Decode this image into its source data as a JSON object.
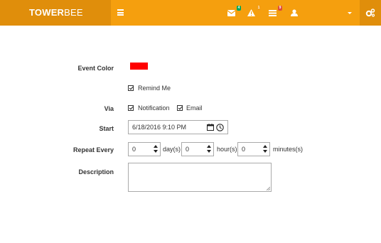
{
  "brand": {
    "bold": "TOWER",
    "light": "BEE"
  },
  "nav": {
    "messages_badge": "4",
    "alerts_badge": "1",
    "tasks_badge": "9"
  },
  "form": {
    "event_color_label": "Event Color",
    "event_color": "#ff0000",
    "remind_me_label": "Remind Me",
    "via_label": "Via",
    "via_notification_label": "Notification",
    "via_email_label": "Email",
    "start_label": "Start",
    "start_value": "6/18/2016 9:10 PM",
    "repeat_every_label": "Repeat Every",
    "repeat_days_value": "0",
    "repeat_days_unit": "day(s)",
    "repeat_hours_value": "0",
    "repeat_hours_unit": "hour(s)",
    "repeat_minutes_value": "0",
    "repeat_minutes_unit": "minutes(s)",
    "description_label": "Description",
    "description_value": ""
  },
  "colors": {
    "topbar": "#f59f0e",
    "brand_bg": "#e08e0b"
  }
}
